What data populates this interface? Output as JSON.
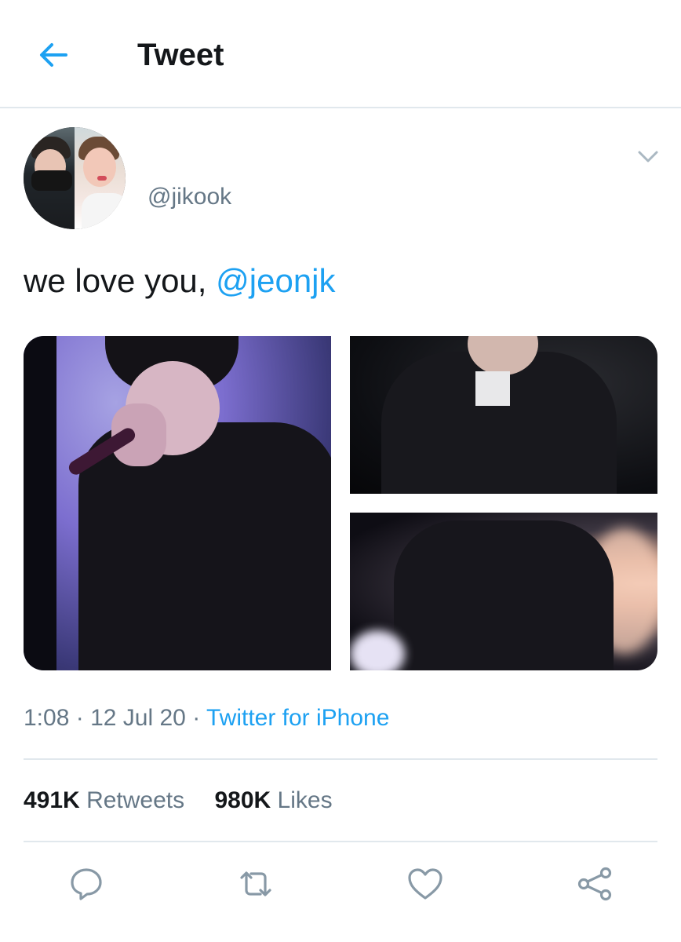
{
  "header": {
    "title": "Tweet",
    "back_icon": "arrow-left-icon"
  },
  "tweet": {
    "author": {
      "handle": "@jikook"
    },
    "text_prefix": "we love you, ",
    "mention": "@jeonjk",
    "photos_count": 3,
    "time": "1:08",
    "date": "12 Jul 20",
    "separator": "·",
    "source": "Twitter for iPhone",
    "stats": {
      "retweets_count": "491K",
      "retweets_label": "Retweets",
      "likes_count": "980K",
      "likes_label": "Likes"
    }
  },
  "actions": [
    {
      "name": "reply",
      "icon": "reply-icon"
    },
    {
      "name": "retweet",
      "icon": "retweet-icon"
    },
    {
      "name": "like",
      "icon": "heart-icon"
    },
    {
      "name": "share",
      "icon": "share-icon"
    }
  ],
  "colors": {
    "accent": "#1da1f2",
    "text_primary": "#14171a",
    "text_secondary": "#657786",
    "divider": "#e1e8ed",
    "icon_gray": "#8899a6"
  }
}
